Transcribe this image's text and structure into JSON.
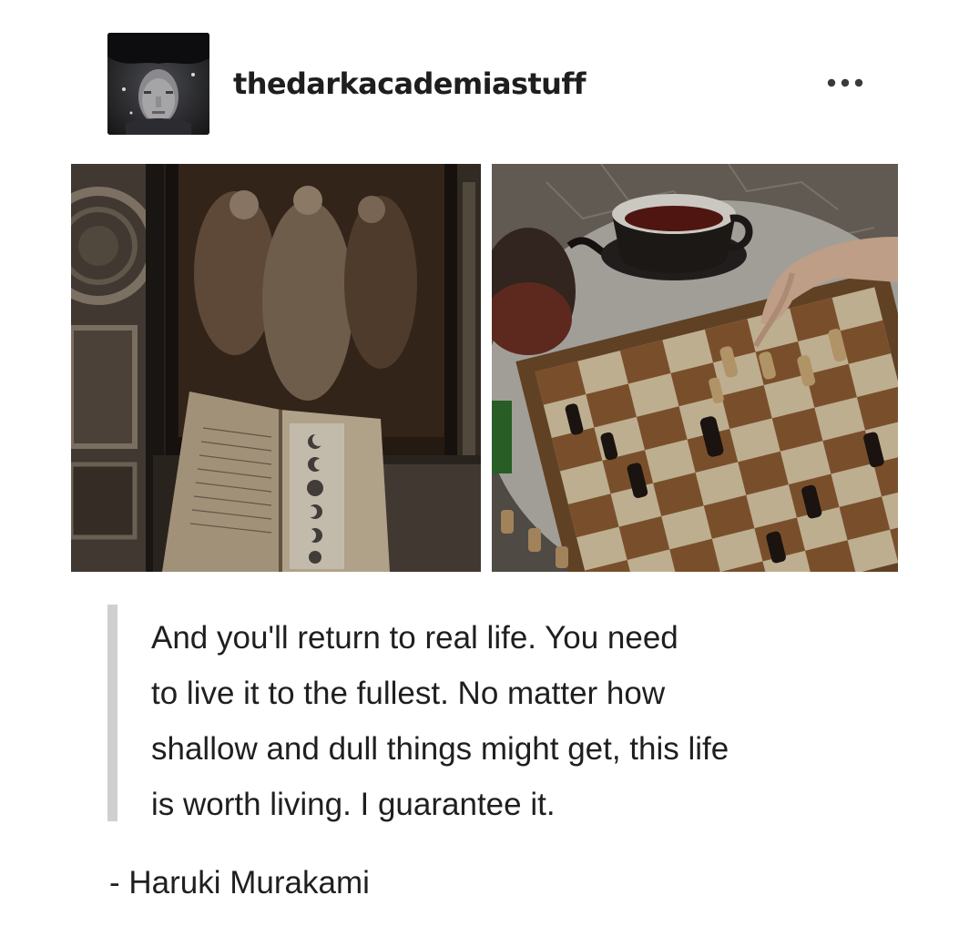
{
  "post": {
    "username": "thedarkacademiastuff",
    "avatar_icon": "avatar-photo",
    "more_icon": "ellipsis-icon"
  },
  "images": [
    {
      "name": "renaissance-painting-and-book-photo",
      "icon": "photo"
    },
    {
      "name": "chess-board-and-tea-photo",
      "icon": "photo"
    }
  ],
  "quote": {
    "lines": [
      "And you'll return to real life. You need",
      "to live it to the fullest. No matter how",
      "shallow and dull things might get, this life",
      "is worth living. I guarantee it."
    ],
    "attribution": "- Haruki Murakami"
  },
  "colors": {
    "text": "#1f1f1f",
    "quote_bar": "#cfcfcf",
    "background": "#ffffff"
  }
}
